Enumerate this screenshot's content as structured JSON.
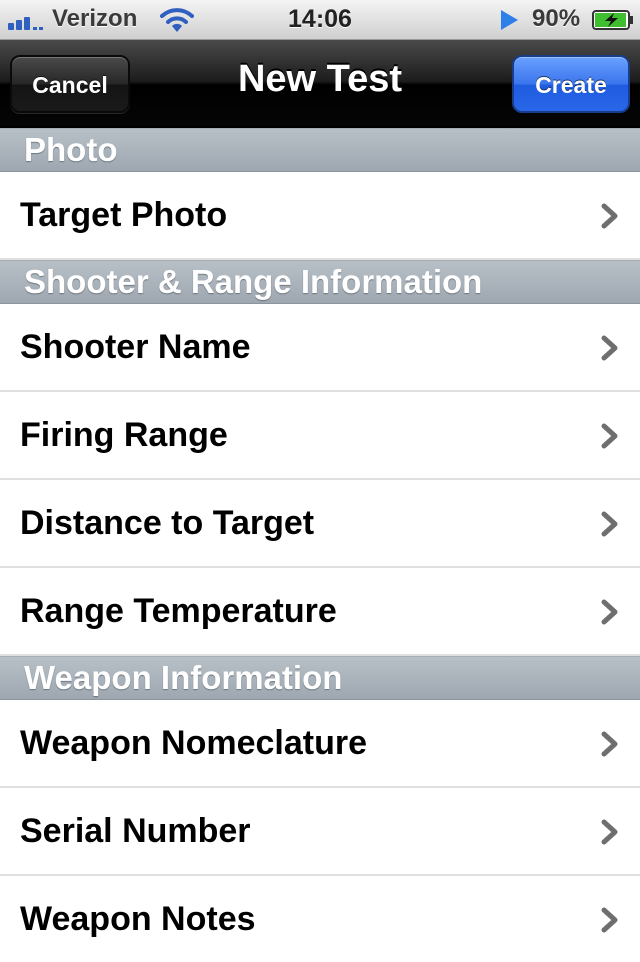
{
  "status_bar": {
    "carrier": "Verizon",
    "time": "14:06",
    "battery_percent": "90%",
    "signal_icon": "signal-bars-icon",
    "wifi_icon": "wifi-icon",
    "play_icon": "location-play-icon",
    "battery_icon": "battery-charging-icon"
  },
  "nav": {
    "title": "New Test",
    "cancel_label": "Cancel",
    "create_label": "Create",
    "create_color": "#2a66e8"
  },
  "sections": [
    {
      "title": "Photo",
      "rows": [
        "Target Photo"
      ]
    },
    {
      "title": "Shooter & Range Information",
      "rows": [
        "Shooter Name",
        "Firing Range",
        "Distance to Target",
        "Range Temperature"
      ]
    },
    {
      "title": "Weapon Information",
      "rows": [
        "Weapon Nomeclature",
        "Serial Number",
        "Weapon Notes"
      ]
    }
  ],
  "row_icon": "chevron-right-icon"
}
